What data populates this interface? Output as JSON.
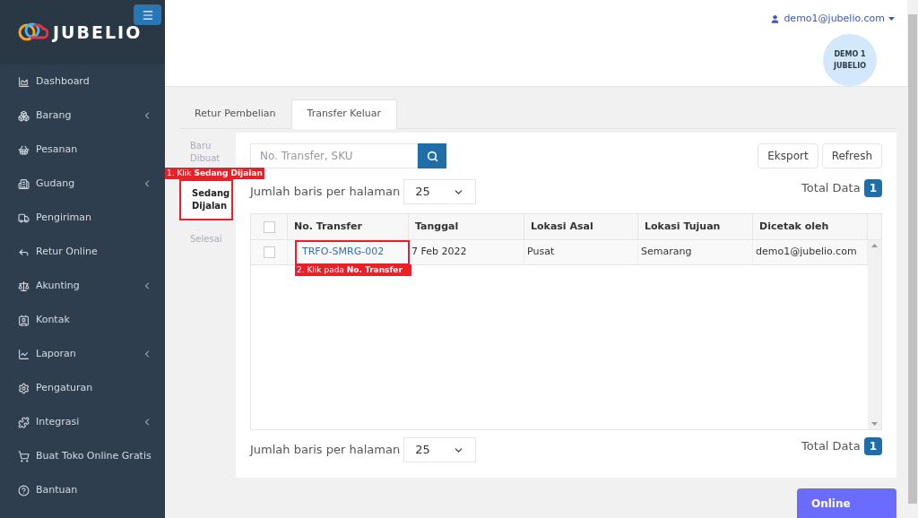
{
  "brand": {
    "name": "JUBELIO"
  },
  "sidebar": {
    "items": [
      {
        "label": "Dashboard",
        "expandable": false
      },
      {
        "label": "Barang",
        "expandable": true
      },
      {
        "label": "Pesanan",
        "expandable": false
      },
      {
        "label": "Gudang",
        "expandable": true
      },
      {
        "label": "Pengiriman",
        "expandable": false
      },
      {
        "label": "Retur Online",
        "expandable": false
      },
      {
        "label": "Akunting",
        "expandable": true
      },
      {
        "label": "Kontak",
        "expandable": false
      },
      {
        "label": "Laporan",
        "expandable": true
      },
      {
        "label": "Pengaturan",
        "expandable": false
      },
      {
        "label": "Integrasi",
        "expandable": true
      },
      {
        "label": "Buat Toko Online Gratis",
        "expandable": false
      },
      {
        "label": "Bantuan",
        "expandable": false
      }
    ]
  },
  "header": {
    "user": "demo1@jubelio.com",
    "avatar": [
      "DEMO 1",
      "JUBELIO"
    ]
  },
  "tabs": [
    {
      "label": "Retur Pembelian",
      "selected": false
    },
    {
      "label": "Transfer Keluar",
      "selected": true
    }
  ],
  "status_tabs": [
    {
      "label": "Baru Dibuat",
      "selected": false
    },
    {
      "label": "Sedang Dijalan",
      "selected": true,
      "annotation": "1. Klik **Sedang Dijalan**"
    },
    {
      "label": "Selesai",
      "selected": false
    }
  ],
  "search": {
    "placeholder": "No. Transfer, SKU"
  },
  "buttons": [
    "Eksport",
    "Refresh"
  ],
  "pager_top": {
    "label": "Jumlah baris per halaman",
    "value": "25",
    "total_label": "Total Data",
    "total": "1"
  },
  "table": {
    "select_all_checked": false,
    "columns": [
      "No. Transfer",
      "Tanggal",
      "Lokasi Asal",
      "Lokasi Tujuan",
      "Dicetak oleh"
    ],
    "rows": [
      {
        "checked": false,
        "cells": [
          "TRFO-SMRG-002",
          "7 Feb 2022",
          "Pusat",
          "Semarang",
          "demo1@jubelio.com"
        ],
        "annotation": "2. Klik pada **No. Transfer**"
      }
    ]
  },
  "pager_bottom": {
    "label": "Jumlah baris per halaman",
    "value": "25",
    "total_label": "Total Data",
    "total": "1"
  },
  "chat_button": "Online"
}
